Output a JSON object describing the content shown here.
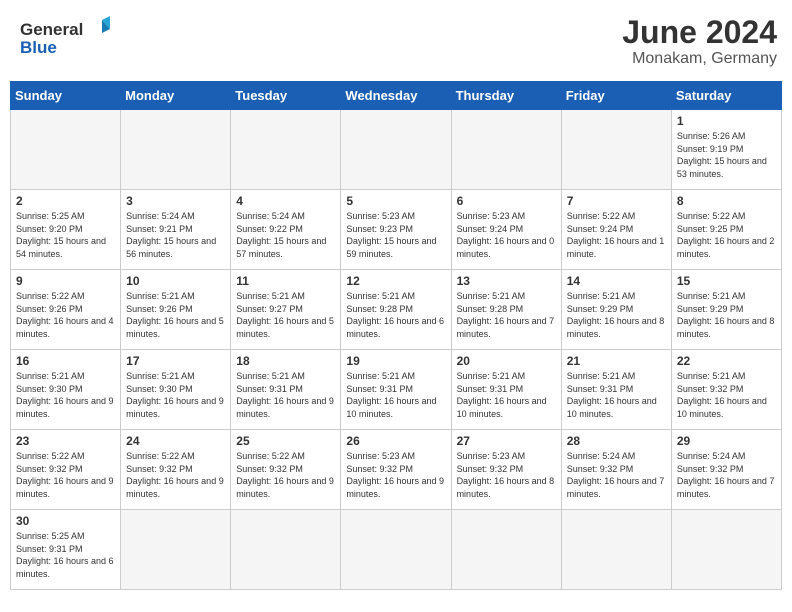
{
  "header": {
    "logo_general": "General",
    "logo_blue": "Blue",
    "title": "June 2024",
    "subtitle": "Monakam, Germany"
  },
  "columns": [
    "Sunday",
    "Monday",
    "Tuesday",
    "Wednesday",
    "Thursday",
    "Friday",
    "Saturday"
  ],
  "weeks": [
    {
      "days": [
        {
          "num": "",
          "info": ""
        },
        {
          "num": "",
          "info": ""
        },
        {
          "num": "",
          "info": ""
        },
        {
          "num": "",
          "info": ""
        },
        {
          "num": "",
          "info": ""
        },
        {
          "num": "",
          "info": ""
        },
        {
          "num": "1",
          "info": "Sunrise: 5:26 AM\nSunset: 9:19 PM\nDaylight: 15 hours\nand 53 minutes."
        }
      ]
    },
    {
      "days": [
        {
          "num": "2",
          "info": "Sunrise: 5:25 AM\nSunset: 9:20 PM\nDaylight: 15 hours\nand 54 minutes."
        },
        {
          "num": "3",
          "info": "Sunrise: 5:24 AM\nSunset: 9:21 PM\nDaylight: 15 hours\nand 56 minutes."
        },
        {
          "num": "4",
          "info": "Sunrise: 5:24 AM\nSunset: 9:22 PM\nDaylight: 15 hours\nand 57 minutes."
        },
        {
          "num": "5",
          "info": "Sunrise: 5:23 AM\nSunset: 9:23 PM\nDaylight: 15 hours\nand 59 minutes."
        },
        {
          "num": "6",
          "info": "Sunrise: 5:23 AM\nSunset: 9:24 PM\nDaylight: 16 hours\nand 0 minutes."
        },
        {
          "num": "7",
          "info": "Sunrise: 5:22 AM\nSunset: 9:24 PM\nDaylight: 16 hours\nand 1 minute."
        },
        {
          "num": "8",
          "info": "Sunrise: 5:22 AM\nSunset: 9:25 PM\nDaylight: 16 hours\nand 2 minutes."
        }
      ]
    },
    {
      "days": [
        {
          "num": "9",
          "info": "Sunrise: 5:22 AM\nSunset: 9:26 PM\nDaylight: 16 hours\nand 4 minutes."
        },
        {
          "num": "10",
          "info": "Sunrise: 5:21 AM\nSunset: 9:26 PM\nDaylight: 16 hours\nand 5 minutes."
        },
        {
          "num": "11",
          "info": "Sunrise: 5:21 AM\nSunset: 9:27 PM\nDaylight: 16 hours\nand 5 minutes."
        },
        {
          "num": "12",
          "info": "Sunrise: 5:21 AM\nSunset: 9:28 PM\nDaylight: 16 hours\nand 6 minutes."
        },
        {
          "num": "13",
          "info": "Sunrise: 5:21 AM\nSunset: 9:28 PM\nDaylight: 16 hours\nand 7 minutes."
        },
        {
          "num": "14",
          "info": "Sunrise: 5:21 AM\nSunset: 9:29 PM\nDaylight: 16 hours\nand 8 minutes."
        },
        {
          "num": "15",
          "info": "Sunrise: 5:21 AM\nSunset: 9:29 PM\nDaylight: 16 hours\nand 8 minutes."
        }
      ]
    },
    {
      "days": [
        {
          "num": "16",
          "info": "Sunrise: 5:21 AM\nSunset: 9:30 PM\nDaylight: 16 hours\nand 9 minutes."
        },
        {
          "num": "17",
          "info": "Sunrise: 5:21 AM\nSunset: 9:30 PM\nDaylight: 16 hours\nand 9 minutes."
        },
        {
          "num": "18",
          "info": "Sunrise: 5:21 AM\nSunset: 9:31 PM\nDaylight: 16 hours\nand 9 minutes."
        },
        {
          "num": "19",
          "info": "Sunrise: 5:21 AM\nSunset: 9:31 PM\nDaylight: 16 hours\nand 10 minutes."
        },
        {
          "num": "20",
          "info": "Sunrise: 5:21 AM\nSunset: 9:31 PM\nDaylight: 16 hours\nand 10 minutes."
        },
        {
          "num": "21",
          "info": "Sunrise: 5:21 AM\nSunset: 9:31 PM\nDaylight: 16 hours\nand 10 minutes."
        },
        {
          "num": "22",
          "info": "Sunrise: 5:21 AM\nSunset: 9:32 PM\nDaylight: 16 hours\nand 10 minutes."
        }
      ]
    },
    {
      "days": [
        {
          "num": "23",
          "info": "Sunrise: 5:22 AM\nSunset: 9:32 PM\nDaylight: 16 hours\nand 9 minutes."
        },
        {
          "num": "24",
          "info": "Sunrise: 5:22 AM\nSunset: 9:32 PM\nDaylight: 16 hours\nand 9 minutes."
        },
        {
          "num": "25",
          "info": "Sunrise: 5:22 AM\nSunset: 9:32 PM\nDaylight: 16 hours\nand 9 minutes."
        },
        {
          "num": "26",
          "info": "Sunrise: 5:23 AM\nSunset: 9:32 PM\nDaylight: 16 hours\nand 9 minutes."
        },
        {
          "num": "27",
          "info": "Sunrise: 5:23 AM\nSunset: 9:32 PM\nDaylight: 16 hours\nand 8 minutes."
        },
        {
          "num": "28",
          "info": "Sunrise: 5:24 AM\nSunset: 9:32 PM\nDaylight: 16 hours\nand 7 minutes."
        },
        {
          "num": "29",
          "info": "Sunrise: 5:24 AM\nSunset: 9:32 PM\nDaylight: 16 hours\nand 7 minutes."
        }
      ]
    },
    {
      "days": [
        {
          "num": "30",
          "info": "Sunrise: 5:25 AM\nSunset: 9:31 PM\nDaylight: 16 hours\nand 6 minutes."
        },
        {
          "num": "",
          "info": ""
        },
        {
          "num": "",
          "info": ""
        },
        {
          "num": "",
          "info": ""
        },
        {
          "num": "",
          "info": ""
        },
        {
          "num": "",
          "info": ""
        },
        {
          "num": "",
          "info": ""
        }
      ]
    }
  ]
}
